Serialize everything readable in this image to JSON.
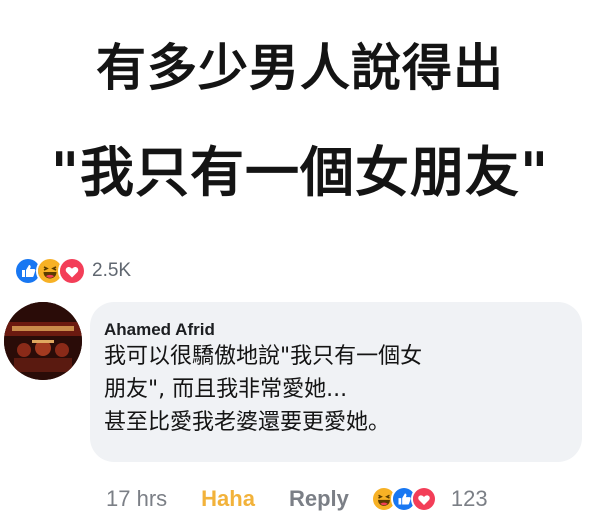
{
  "headline": {
    "line1": "有多少男人說得出",
    "line2": "\"我只有一個女朋友\""
  },
  "post": {
    "reaction_icons": [
      "like-icon",
      "haha-icon",
      "love-icon"
    ],
    "reaction_count": "2.5K"
  },
  "comment": {
    "author": "Ahamed Afrid",
    "lines": [
      "我可以很驕傲地說\"我只有一個女",
      "朋友\", 而且我非常愛她...",
      "甚至比愛我老婆還要更愛她。"
    ],
    "time": "17 hrs",
    "haha_label": "Haha",
    "reply_label": "Reply",
    "reaction_icons": [
      "haha-icon",
      "like-icon",
      "love-icon"
    ],
    "reaction_count": "123"
  },
  "colors": {
    "like": "#1877f2",
    "haha": "#f7b125",
    "love": "#f33e58",
    "bubble": "#f0f2f5",
    "muted": "#7b7f86"
  }
}
